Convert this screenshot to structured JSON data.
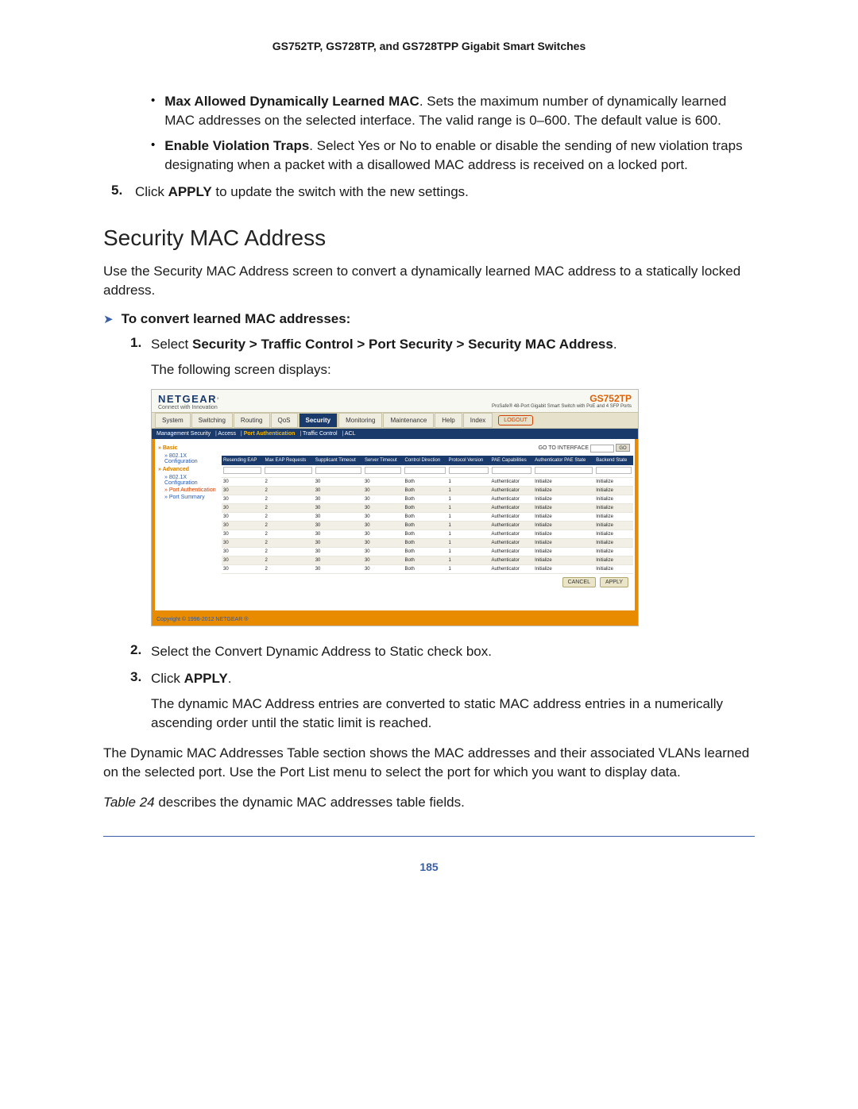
{
  "header": "GS752TP, GS728TP, and GS728TPP Gigabit Smart Switches",
  "bullet1_bold": "Max Allowed Dynamically Learned MAC",
  "bullet1_rest": ". Sets the maximum number of dynamically learned MAC addresses on the selected interface. The valid range is 0–600. The default value is 600.",
  "bullet2_bold": "Enable Violation Traps",
  "bullet2_rest": ". Select Yes or No to enable or disable the sending of new violation traps designating when a packet with a disallowed MAC address is received on a locked port.",
  "step5_num": "5.",
  "step5_a": "Click ",
  "step5_b": "APPLY",
  "step5_c": " to update the switch with the new settings.",
  "section_title": "Security MAC Address",
  "intro": "Use the Security MAC Address screen to convert a dynamically learned MAC address to a statically locked address.",
  "proc_title": "To convert learned MAC addresses:",
  "s1_num": "1.",
  "s1_a": "Select ",
  "s1_b": "Security > Traffic Control > Port Security > Security MAC Address",
  "s1_c": ".",
  "follow": "The following screen displays:",
  "shot": {
    "logo": "NETGEAR",
    "tag": "Connect with Innovation",
    "model": "GS752TP",
    "desc": "ProSafe® 48-Port Gigabit Smart Switch with PoE and 4 SFP Ports",
    "tabs": [
      "System",
      "Switching",
      "Routing",
      "QoS",
      "Security",
      "Monitoring",
      "Maintenance",
      "Help",
      "Index"
    ],
    "logout": "LOGOUT",
    "subtabs": "Management Security | Access | Port Authentication | Traffic Control | ACL",
    "side": {
      "basic": "Basic",
      "b1": "802.1X Configuration",
      "adv": "Advanced",
      "a1": "802.1X Configuration",
      "a2": "Port Authentication",
      "a3": "Port Summary"
    },
    "goto_label": "GO TO INTERFACE",
    "go": "GO",
    "cols": [
      "Resending EAP",
      "Max EAP Requests",
      "Supplicant Timeout",
      "Server Timeout",
      "Control Direction",
      "Protocol Version",
      "PAE Capabilities",
      "Authenticator PAE State",
      "Backend State"
    ],
    "rows": [
      [
        "30",
        "2",
        "30",
        "30",
        "Both",
        "1",
        "Authenticator",
        "Initialize",
        "Initialize"
      ],
      [
        "30",
        "2",
        "30",
        "30",
        "Both",
        "1",
        "Authenticator",
        "Initialize",
        "Initialize"
      ],
      [
        "30",
        "2",
        "30",
        "30",
        "Both",
        "1",
        "Authenticator",
        "Initialize",
        "Initialize"
      ],
      [
        "30",
        "2",
        "30",
        "30",
        "Both",
        "1",
        "Authenticator",
        "Initialize",
        "Initialize"
      ],
      [
        "30",
        "2",
        "30",
        "30",
        "Both",
        "1",
        "Authenticator",
        "Initialize",
        "Initialize"
      ],
      [
        "30",
        "2",
        "30",
        "30",
        "Both",
        "1",
        "Authenticator",
        "Initialize",
        "Initialize"
      ],
      [
        "30",
        "2",
        "30",
        "30",
        "Both",
        "1",
        "Authenticator",
        "Initialize",
        "Initialize"
      ],
      [
        "30",
        "2",
        "30",
        "30",
        "Both",
        "1",
        "Authenticator",
        "Initialize",
        "Initialize"
      ],
      [
        "30",
        "2",
        "30",
        "30",
        "Both",
        "1",
        "Authenticator",
        "Initialize",
        "Initialize"
      ],
      [
        "30",
        "2",
        "30",
        "30",
        "Both",
        "1",
        "Authenticator",
        "Initialize",
        "Initialize"
      ],
      [
        "30",
        "2",
        "30",
        "30",
        "Both",
        "1",
        "Authenticator",
        "Initialize",
        "Initialize"
      ]
    ],
    "cancel": "CANCEL",
    "apply": "APPLY",
    "copyright": "Copyright © 1996-2012 NETGEAR ®"
  },
  "s2_num": "2.",
  "s2": "Select the Convert Dynamic Address to Static check box.",
  "s3_num": "3.",
  "s3_a": "Click ",
  "s3_b": "APPLY",
  "s3_c": ".",
  "s3_p": "The dynamic MAC Address entries are converted to static MAC address entries in a numerically ascending order until the static limit is reached.",
  "p2": "The Dynamic MAC Addresses Table section shows the MAC addresses and their associated VLANs learned on the selected port. Use the Port List menu to select the port for which you want to display data.",
  "p3_a": "Table 24",
  "p3_b": " describes the dynamic MAC addresses table fields.",
  "pagenum": "185"
}
